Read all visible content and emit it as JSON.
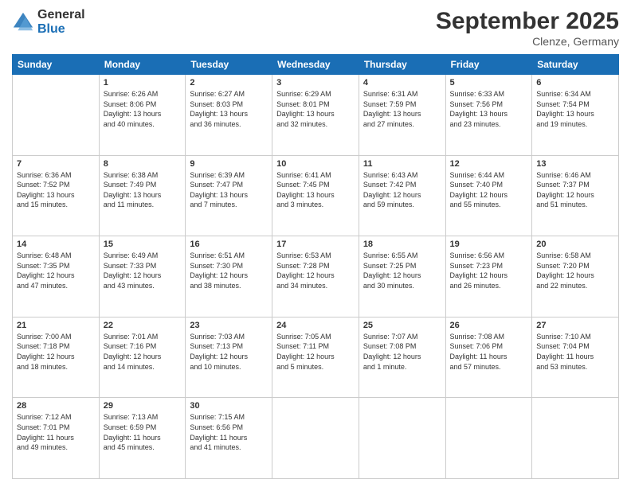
{
  "header": {
    "logo_general": "General",
    "logo_blue": "Blue",
    "month_title": "September 2025",
    "location": "Clenze, Germany"
  },
  "days_of_week": [
    "Sunday",
    "Monday",
    "Tuesday",
    "Wednesday",
    "Thursday",
    "Friday",
    "Saturday"
  ],
  "weeks": [
    [
      {
        "day": "",
        "info": ""
      },
      {
        "day": "1",
        "info": "Sunrise: 6:26 AM\nSunset: 8:06 PM\nDaylight: 13 hours\nand 40 minutes."
      },
      {
        "day": "2",
        "info": "Sunrise: 6:27 AM\nSunset: 8:03 PM\nDaylight: 13 hours\nand 36 minutes."
      },
      {
        "day": "3",
        "info": "Sunrise: 6:29 AM\nSunset: 8:01 PM\nDaylight: 13 hours\nand 32 minutes."
      },
      {
        "day": "4",
        "info": "Sunrise: 6:31 AM\nSunset: 7:59 PM\nDaylight: 13 hours\nand 27 minutes."
      },
      {
        "day": "5",
        "info": "Sunrise: 6:33 AM\nSunset: 7:56 PM\nDaylight: 13 hours\nand 23 minutes."
      },
      {
        "day": "6",
        "info": "Sunrise: 6:34 AM\nSunset: 7:54 PM\nDaylight: 13 hours\nand 19 minutes."
      }
    ],
    [
      {
        "day": "7",
        "info": "Sunrise: 6:36 AM\nSunset: 7:52 PM\nDaylight: 13 hours\nand 15 minutes."
      },
      {
        "day": "8",
        "info": "Sunrise: 6:38 AM\nSunset: 7:49 PM\nDaylight: 13 hours\nand 11 minutes."
      },
      {
        "day": "9",
        "info": "Sunrise: 6:39 AM\nSunset: 7:47 PM\nDaylight: 13 hours\nand 7 minutes."
      },
      {
        "day": "10",
        "info": "Sunrise: 6:41 AM\nSunset: 7:45 PM\nDaylight: 13 hours\nand 3 minutes."
      },
      {
        "day": "11",
        "info": "Sunrise: 6:43 AM\nSunset: 7:42 PM\nDaylight: 12 hours\nand 59 minutes."
      },
      {
        "day": "12",
        "info": "Sunrise: 6:44 AM\nSunset: 7:40 PM\nDaylight: 12 hours\nand 55 minutes."
      },
      {
        "day": "13",
        "info": "Sunrise: 6:46 AM\nSunset: 7:37 PM\nDaylight: 12 hours\nand 51 minutes."
      }
    ],
    [
      {
        "day": "14",
        "info": "Sunrise: 6:48 AM\nSunset: 7:35 PM\nDaylight: 12 hours\nand 47 minutes."
      },
      {
        "day": "15",
        "info": "Sunrise: 6:49 AM\nSunset: 7:33 PM\nDaylight: 12 hours\nand 43 minutes."
      },
      {
        "day": "16",
        "info": "Sunrise: 6:51 AM\nSunset: 7:30 PM\nDaylight: 12 hours\nand 38 minutes."
      },
      {
        "day": "17",
        "info": "Sunrise: 6:53 AM\nSunset: 7:28 PM\nDaylight: 12 hours\nand 34 minutes."
      },
      {
        "day": "18",
        "info": "Sunrise: 6:55 AM\nSunset: 7:25 PM\nDaylight: 12 hours\nand 30 minutes."
      },
      {
        "day": "19",
        "info": "Sunrise: 6:56 AM\nSunset: 7:23 PM\nDaylight: 12 hours\nand 26 minutes."
      },
      {
        "day": "20",
        "info": "Sunrise: 6:58 AM\nSunset: 7:20 PM\nDaylight: 12 hours\nand 22 minutes."
      }
    ],
    [
      {
        "day": "21",
        "info": "Sunrise: 7:00 AM\nSunset: 7:18 PM\nDaylight: 12 hours\nand 18 minutes."
      },
      {
        "day": "22",
        "info": "Sunrise: 7:01 AM\nSunset: 7:16 PM\nDaylight: 12 hours\nand 14 minutes."
      },
      {
        "day": "23",
        "info": "Sunrise: 7:03 AM\nSunset: 7:13 PM\nDaylight: 12 hours\nand 10 minutes."
      },
      {
        "day": "24",
        "info": "Sunrise: 7:05 AM\nSunset: 7:11 PM\nDaylight: 12 hours\nand 5 minutes."
      },
      {
        "day": "25",
        "info": "Sunrise: 7:07 AM\nSunset: 7:08 PM\nDaylight: 12 hours\nand 1 minute."
      },
      {
        "day": "26",
        "info": "Sunrise: 7:08 AM\nSunset: 7:06 PM\nDaylight: 11 hours\nand 57 minutes."
      },
      {
        "day": "27",
        "info": "Sunrise: 7:10 AM\nSunset: 7:04 PM\nDaylight: 11 hours\nand 53 minutes."
      }
    ],
    [
      {
        "day": "28",
        "info": "Sunrise: 7:12 AM\nSunset: 7:01 PM\nDaylight: 11 hours\nand 49 minutes."
      },
      {
        "day": "29",
        "info": "Sunrise: 7:13 AM\nSunset: 6:59 PM\nDaylight: 11 hours\nand 45 minutes."
      },
      {
        "day": "30",
        "info": "Sunrise: 7:15 AM\nSunset: 6:56 PM\nDaylight: 11 hours\nand 41 minutes."
      },
      {
        "day": "",
        "info": ""
      },
      {
        "day": "",
        "info": ""
      },
      {
        "day": "",
        "info": ""
      },
      {
        "day": "",
        "info": ""
      }
    ]
  ]
}
